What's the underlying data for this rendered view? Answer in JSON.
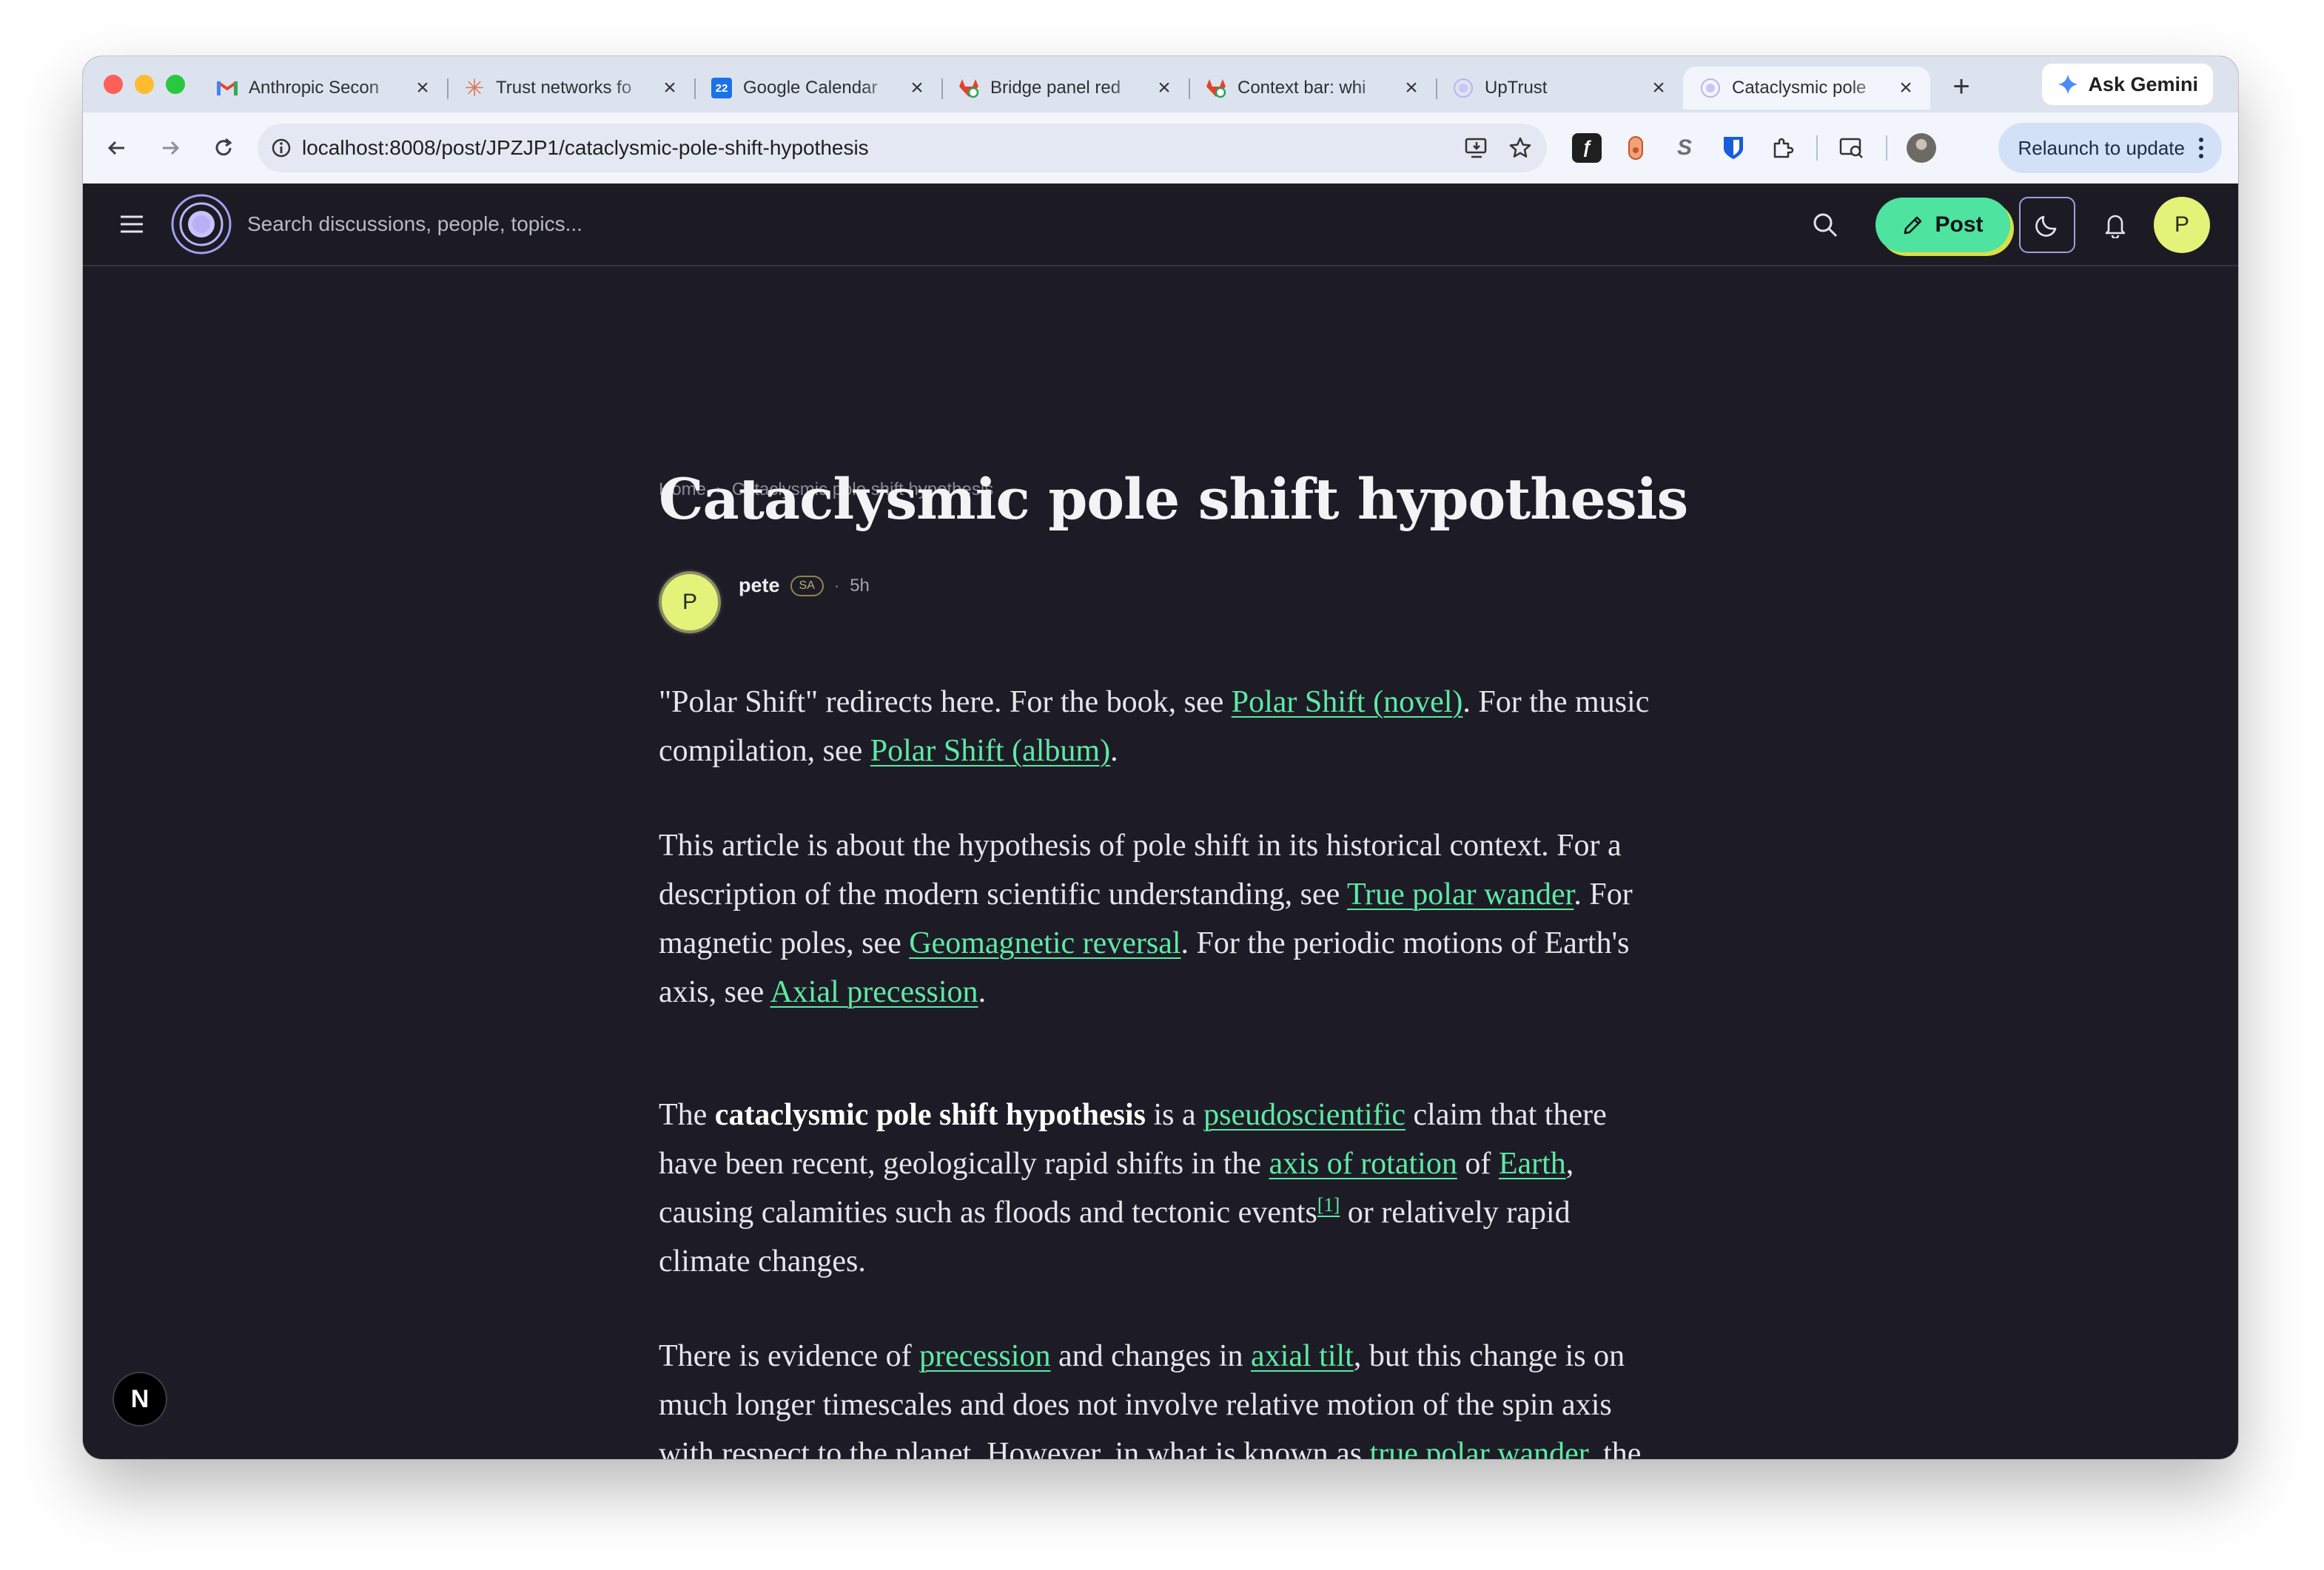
{
  "browser": {
    "tabs": [
      {
        "title": "Anthropic Secon",
        "favicon": "gmail-icon",
        "active": false
      },
      {
        "title": "Trust networks fo",
        "favicon": "claude-icon",
        "active": false
      },
      {
        "title": "Google Calendar",
        "favicon": "calendar-icon",
        "favicon_text": "22",
        "active": false
      },
      {
        "title": "Bridge panel red",
        "favicon": "gitlab-icon",
        "active": false
      },
      {
        "title": "Context bar: whi",
        "favicon": "gitlab-icon",
        "active": false
      },
      {
        "title": "UpTrust",
        "favicon": "uptrust-icon",
        "active": false
      },
      {
        "title": "Cataclysmic pole",
        "favicon": "uptrust-icon",
        "active": true
      }
    ],
    "new_tab": "+",
    "gemini_label": "Ask Gemini",
    "url": "localhost:8008/post/JPZJP1/cataclysmic-pole-shift-hypothesis",
    "relaunch_label": "Relaunch to update"
  },
  "header": {
    "search_placeholder": "Search discussions, people, topics...",
    "post_label": "Post",
    "avatar_initial": "P"
  },
  "breadcrumb": {
    "home": "Home",
    "current": "Cataclysmic pole shift hypothesis"
  },
  "post": {
    "title": "Cataclysmic pole shift hypothesis",
    "author": {
      "name": "pete",
      "badge": "SA",
      "initial": "P"
    },
    "separator": "·",
    "time": "5h"
  },
  "article": {
    "p1": {
      "t1": "\"Polar Shift\" redirects here. For the book, see ",
      "l1": "Polar Shift (novel)",
      "t2": ". For the music compilation, see ",
      "l2": "Polar Shift (album)",
      "t3": "."
    },
    "p2": {
      "t1": "This article is about the hypothesis of pole shift in its historical context. For a description of the modern scientific understanding, see ",
      "l1": "True polar wander",
      "t2": ". For magnetic poles, see ",
      "l2": "Geomagnetic reversal",
      "t3": ". For the periodic motions of Earth's axis, see ",
      "l3": "Axial precession",
      "t4": "."
    },
    "p3": {
      "t1": "The ",
      "bold": "cataclysmic pole shift hypothesis",
      "t2": " is a ",
      "l1": "pseudoscientific",
      "t3": " claim that there have been recent, geologically rapid shifts in the ",
      "l2": "axis of rotation",
      "t4": " of ",
      "l3": "Earth",
      "t5": ", causing calamities such as floods and tectonic events",
      "ref": "[1]",
      "t6": " or relatively rapid climate changes."
    },
    "p4": {
      "t1": "There is evidence of ",
      "l1": "precession",
      "t2": " and changes in ",
      "l2": "axial tilt",
      "t3": ", but this change is on much longer timescales and does not involve relative motion of the spin axis with respect to the planet. However, in what is known as ",
      "l3": "true polar wander",
      "t4": ", the Earth rotates with respect to a fixed spin axis."
    }
  },
  "dev_badge": "N",
  "colors": {
    "accent_green": "#4ee39e",
    "link": "#5eeaa4",
    "avatar": "#e3f37a",
    "background": "#1d1c26"
  }
}
